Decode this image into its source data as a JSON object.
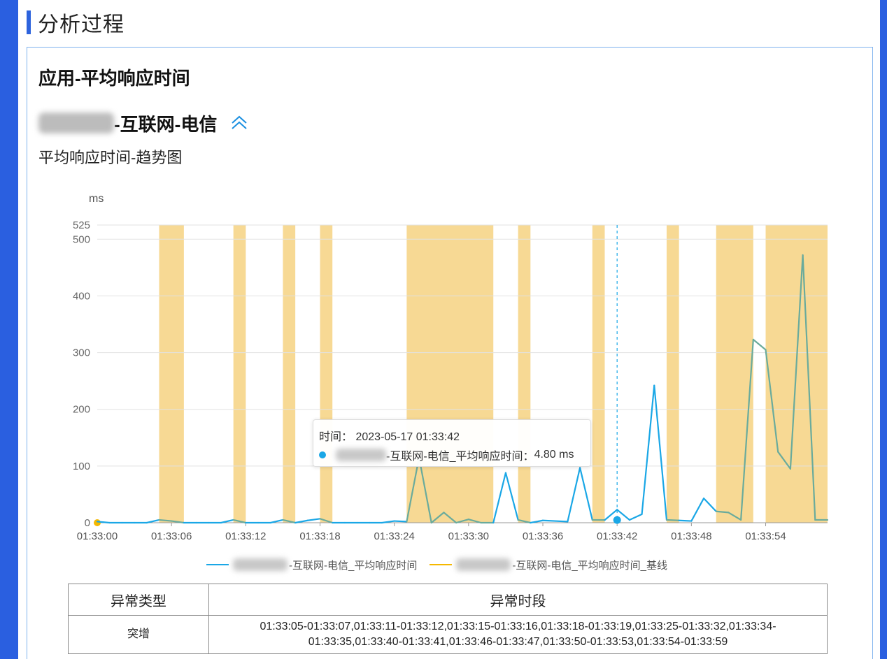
{
  "section": {
    "title": "分析过程"
  },
  "card": {
    "title": "应用-平均响应时间",
    "subheading": "-互联网-电信",
    "trend_title": "平均响应时间-趋势图",
    "collapse_icon": "chevron-double-up-icon"
  },
  "colors": {
    "line": "#1aa7e6",
    "baseline": "#f5b800",
    "anomaly_band": "#f7d994",
    "overlap_line": "#6aab9c",
    "accent_bar": "#2d63dd",
    "page_frame": "#2a5fe0"
  },
  "tooltip": {
    "time_label": "时间：",
    "time_value": "2023-05-17 01:33:42",
    "series_label": "-互联网-电信_平均响应时间：",
    "series_value": "4.80 ms"
  },
  "chart_data": {
    "type": "line",
    "ylabel": "ms",
    "ylim": [
      0,
      525
    ],
    "y_ticks": [
      0,
      100,
      200,
      300,
      400,
      500,
      525
    ],
    "x_tick_labels": [
      "01:33:00",
      "01:33:06",
      "01:33:12",
      "01:33:18",
      "01:33:24",
      "01:33:30",
      "01:33:36",
      "01:33:42",
      "01:33:48",
      "01:33:54"
    ],
    "x": [
      "01:33:00",
      "01:33:01",
      "01:33:02",
      "01:33:03",
      "01:33:04",
      "01:33:05",
      "01:33:06",
      "01:33:07",
      "01:33:08",
      "01:33:09",
      "01:33:10",
      "01:33:11",
      "01:33:12",
      "01:33:13",
      "01:33:14",
      "01:33:15",
      "01:33:16",
      "01:33:17",
      "01:33:18",
      "01:33:19",
      "01:33:20",
      "01:33:21",
      "01:33:22",
      "01:33:23",
      "01:33:24",
      "01:33:25",
      "01:33:26",
      "01:33:27",
      "01:33:28",
      "01:33:29",
      "01:33:30",
      "01:33:31",
      "01:33:32",
      "01:33:33",
      "01:33:34",
      "01:33:35",
      "01:33:36",
      "01:33:37",
      "01:33:38",
      "01:33:39",
      "01:33:40",
      "01:33:41",
      "01:33:42",
      "01:33:43",
      "01:33:44",
      "01:33:45",
      "01:33:46",
      "01:33:47",
      "01:33:48",
      "01:33:49",
      "01:33:50",
      "01:33:51",
      "01:33:52",
      "01:33:53",
      "01:33:54",
      "01:33:55",
      "01:33:56",
      "01:33:57",
      "01:33:58",
      "01:33:59"
    ],
    "series": [
      {
        "name": "-互联网-电信_平均响应时间",
        "values": [
          2,
          0,
          0,
          0,
          0,
          5,
          3,
          0,
          0,
          0,
          0,
          5,
          0,
          0,
          0,
          5,
          0,
          4,
          7,
          0,
          0,
          0,
          0,
          0,
          3,
          2,
          115,
          0,
          18,
          0,
          6,
          0,
          0,
          88,
          5,
          0,
          4,
          3,
          2,
          97,
          5,
          4.8,
          23,
          5,
          15,
          242,
          5,
          4,
          3,
          43,
          20,
          18,
          5,
          323,
          305,
          125,
          95,
          472,
          5,
          5
        ]
      },
      {
        "name": "-互联网-电信_平均响应时间_基线",
        "values": [
          0
        ]
      }
    ],
    "anomaly_bands": [
      [
        "01:33:05",
        "01:33:07"
      ],
      [
        "01:33:11",
        "01:33:12"
      ],
      [
        "01:33:15",
        "01:33:16"
      ],
      [
        "01:33:18",
        "01:33:19"
      ],
      [
        "01:33:25",
        "01:33:32"
      ],
      [
        "01:33:34",
        "01:33:35"
      ],
      [
        "01:33:40",
        "01:33:41"
      ],
      [
        "01:33:46",
        "01:33:47"
      ],
      [
        "01:33:50",
        "01:33:53"
      ],
      [
        "01:33:54",
        "01:33:59"
      ]
    ],
    "highlight": {
      "x": "01:33:42",
      "value": 4.8
    },
    "grid": true,
    "legend_position": "bottom"
  },
  "table": {
    "headers": [
      "异常类型",
      "异常时段"
    ],
    "rows": [
      {
        "type": "突增",
        "periods_line1": "01:33:05-01:33:07,01:33:11-01:33:12,01:33:15-01:33:16,01:33:18-01:33:19,01:33:25-01:33:32,01:33:34-",
        "periods_line2": "01:33:35,01:33:40-01:33:41,01:33:46-01:33:47,01:33:50-01:33:53,01:33:54-01:33:59"
      }
    ]
  }
}
